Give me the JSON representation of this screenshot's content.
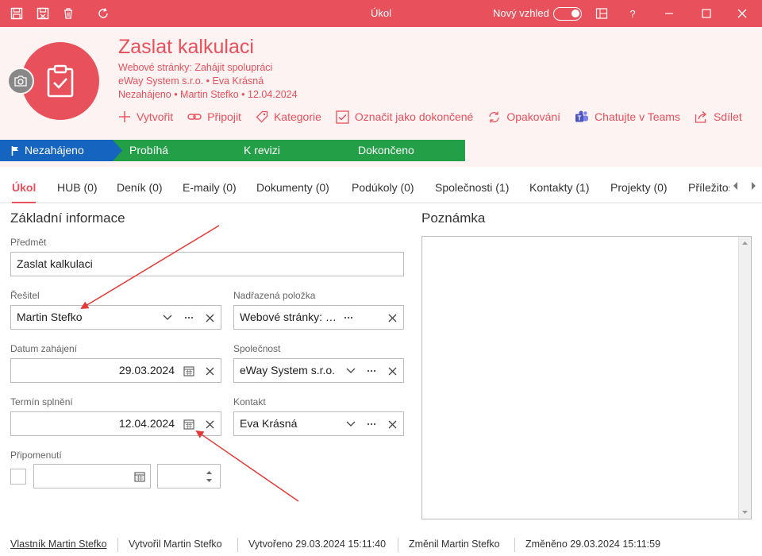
{
  "titlebar": {
    "title": "Úkol",
    "new_look_label": "Nový vzhled",
    "help": "?"
  },
  "record": {
    "title": "Zaslat kalkulaci",
    "meta_lines": [
      "Webové stránky: Zahájit spolupráci",
      "eWay System s.r.o. • Eva Krásná",
      "Nezahájeno • Martin Stefko • 12.04.2024"
    ]
  },
  "actions": [
    {
      "label": "Vytvořit",
      "icon": "plus-icon"
    },
    {
      "label": "Připojit",
      "icon": "link-icon"
    },
    {
      "label": "Kategorie",
      "icon": "tag-icon"
    },
    {
      "label": "Označit jako dokončené",
      "icon": "checkbox-icon"
    },
    {
      "label": "Opakování",
      "icon": "repeat-icon"
    },
    {
      "label": "Chatujte v Teams",
      "icon": "teams-icon"
    },
    {
      "label": "Sdílet",
      "icon": "share-icon"
    }
  ],
  "stages": [
    {
      "label": "Nezahájeno",
      "color": "#1565c0",
      "active": true
    },
    {
      "label": "Probíhá",
      "color": "#23a047"
    },
    {
      "label": "K revizi",
      "color": "#23a047"
    },
    {
      "label": "Dokončeno",
      "color": "#23a047"
    }
  ],
  "tabs": [
    {
      "label": "Úkol",
      "active": true
    },
    {
      "label": "HUB (0)"
    },
    {
      "label": "Deník (0)"
    },
    {
      "label": "E-maily (0)"
    },
    {
      "label": "Dokumenty (0)"
    },
    {
      "label": "Podúkoly (0)"
    },
    {
      "label": "Společnosti (1)"
    },
    {
      "label": "Kontakty (1)"
    },
    {
      "label": "Projekty (0)"
    },
    {
      "label": "Příležitosti"
    }
  ],
  "form": {
    "section_title": "Základní informace",
    "subject": {
      "label": "Předmět",
      "value": "Zaslat kalkulaci"
    },
    "solver": {
      "label": "Řešitel",
      "value": "Martin Stefko"
    },
    "parent": {
      "label": "Nadřazená položka",
      "value": "Webové stránky: Zahájit spolupráci"
    },
    "start_date": {
      "label": "Datum zahájení",
      "value": "29.03.2024"
    },
    "company": {
      "label": "Společnost",
      "value": "eWay System s.r.o."
    },
    "due_date": {
      "label": "Termín splnění",
      "value": "12.04.2024"
    },
    "contact": {
      "label": "Kontakt",
      "value": "Eva Krásná"
    },
    "reminder": {
      "label": "Připomenutí",
      "date": "",
      "time": ""
    }
  },
  "note": {
    "title": "Poznámka",
    "value": ""
  },
  "footer": {
    "owner": "Vlastník Martin Stefko",
    "created_by": "Vytvořil Martin Stefko",
    "created_at": "Vytvořeno 29.03.2024 15:11:40",
    "changed_by": "Změnil Martin Stefko",
    "changed_at": "Změněno 29.03.2024 15:11:59"
  },
  "colors": {
    "accent": "#e8505b",
    "header_bg": "#fdf3f3",
    "stage_active": "#1565c0",
    "stage": "#23a047",
    "annotation": "#e53935"
  }
}
